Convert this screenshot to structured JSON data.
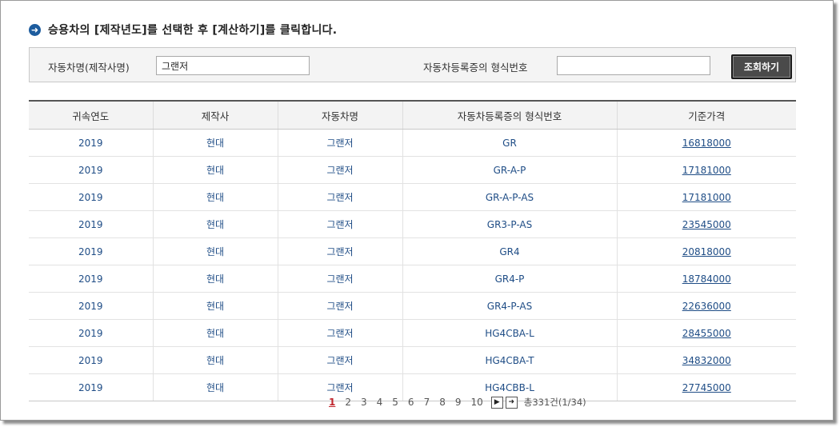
{
  "title": "승용차의 [제작년도]를 선택한 후 [계산하기]를 클릭합니다.",
  "search": {
    "name_label": "자동차명(제작사명)",
    "name_value": "그랜저",
    "type_label": "자동차등록증의 형식번호",
    "type_value": "",
    "button_label": "조회하기"
  },
  "table": {
    "headers": [
      "귀속연도",
      "제작사",
      "자동차명",
      "자동차등록증의 형식번호",
      "기준가격"
    ],
    "rows": [
      [
        "2019",
        "현대",
        "그랜저",
        "GR",
        "16818000"
      ],
      [
        "2019",
        "현대",
        "그랜저",
        "GR-A-P",
        "17181000"
      ],
      [
        "2019",
        "현대",
        "그랜저",
        "GR-A-P-AS",
        "17181000"
      ],
      [
        "2019",
        "현대",
        "그랜저",
        "GR3-P-AS",
        "23545000"
      ],
      [
        "2019",
        "현대",
        "그랜저",
        "GR4",
        "20818000"
      ],
      [
        "2019",
        "현대",
        "그랜저",
        "GR4-P",
        "18784000"
      ],
      [
        "2019",
        "현대",
        "그랜저",
        "GR4-P-AS",
        "22636000"
      ],
      [
        "2019",
        "현대",
        "그랜저",
        "HG4CBA-L",
        "28455000"
      ],
      [
        "2019",
        "현대",
        "그랜저",
        "HG4CBA-T",
        "34832000"
      ],
      [
        "2019",
        "현대",
        "그랜저",
        "HG4CBB-L",
        "27745000"
      ]
    ]
  },
  "pagination": {
    "pages": [
      "1",
      "2",
      "3",
      "4",
      "5",
      "6",
      "7",
      "8",
      "9",
      "10"
    ],
    "current": "1",
    "next_icon": "next-page-icon",
    "last_icon": "last-page-icon",
    "total": "총331건(1/34)"
  },
  "colors": {
    "accent": "#1d5c9e",
    "link": "#1f4d86",
    "current_page": "#c0262d"
  }
}
